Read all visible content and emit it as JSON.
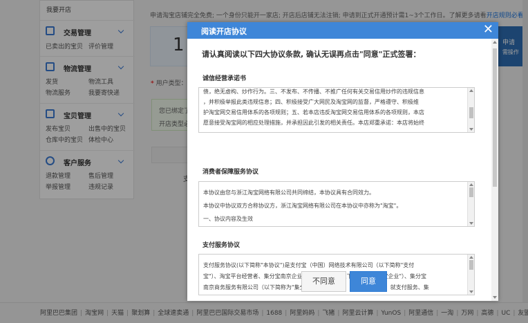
{
  "sidebar": {
    "top_link": "我要开店",
    "sections": [
      {
        "title": "交易管理",
        "links": [
          "已卖出的宝贝",
          "评价管理"
        ]
      },
      {
        "title": "物流管理",
        "links": [
          "发货",
          "物流工具",
          "物流服务",
          "我要寄快递"
        ]
      },
      {
        "title": "宝贝管理",
        "links": [
          "发布宝贝",
          "出售中的宝贝",
          "仓库中的宝贝",
          "体检中心"
        ]
      },
      {
        "title": "客户服务",
        "links": [
          "退款管理",
          "售后管理",
          "举报管理",
          "违规记录"
        ]
      }
    ]
  },
  "main": {
    "info_text": "申请淘宝店铺完全免费; 一个身份只能开一家店; 开店后店铺无法注销; 申请到正式开通预计需1~3个工作日。了解更多请看",
    "info_link": "开店规则必看",
    "step_number": "1",
    "step_right_line1": "申请",
    "step_right_line2": "需操作",
    "user_type_label": "用户类型：",
    "green_line1": "您已绑定了",
    "green_line2": "开店类型必",
    "gray_text": "支"
  },
  "footer": {
    "links": [
      "阿里巴巴集团",
      "淘宝网",
      "天猫",
      "聚划算",
      "全球速卖通",
      "阿里巴巴国际交易市场",
      "1688",
      "阿里妈妈",
      "飞猪",
      "阿里云计算",
      "YunOS",
      "阿里通信",
      "一淘",
      "万网",
      "高德",
      "UC",
      "友盟"
    ]
  },
  "modal": {
    "title": "阅读开店协议",
    "close_glyph": "✕",
    "intro": "请认真阅读以下四大协议条款, 确认无误再点击\"同意\"正式签署：",
    "sections": [
      {
        "title": "诚信经营承诺书",
        "lines": [
          "债，绝无虚构、炒作行为。三、不发布、不传播、不推广任何有关交易信用炒作的违规信息",
          "，并积极举报此类违规信息；四、积极接受广大网民及淘宝网的监督，严格遵守、积极维",
          "护淘宝网交易信用体系的各项规则；五、若本店违反淘宝网交易信用体系的各项规则，本店",
          "愿意接受淘宝网的相应处理措施，并承担因此引发的相关责任。本店郑重承诺：本店将始终"
        ]
      },
      {
        "title": "消费者保障服务协议",
        "lines": [
          "本协议由您与浙江淘宝网络有限公司共同缔结，本协议具有合同效力。",
          "本协议中协议双方合称协议方，浙江淘宝网络有限公司在本协议中亦称为\"淘宝\"。",
          "一、协议内容及生效"
        ]
      },
      {
        "title": "支付服务协议",
        "lines": [
          "支付服务协议(以下简称\"本协议\")是支付宝（中国）网络技术有限公司（以下简称\"支付",
          "宝\"）、淘宝平台经营者、集分宝南京企业管理有限公司（以下简称为\"集分宝企业\"）、集分宝",
          "南京商务服务有限公司（以下简称为\"集分宝商务\"）与用户（以下简称\"您\"）就支付服务、集"
        ]
      }
    ],
    "btn_disagree": "不同意",
    "btn_agree": "同意"
  },
  "colors": {
    "header_blue": "#3e86d8",
    "link_blue": "#1a74e0",
    "required_red": "#e33"
  },
  "icons": [
    "trade-icon",
    "truck-icon",
    "shirt-icon",
    "customer-service-icon",
    "close-icon",
    "chevron-down-icon"
  ]
}
